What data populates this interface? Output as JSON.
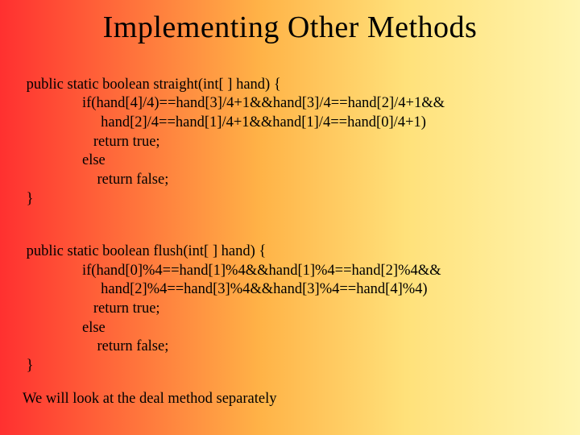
{
  "title": "Implementing Other Methods",
  "code1": {
    "l1": " public static boolean straight(int[ ] hand) {",
    "l2": "                if(hand[4]/4)==hand[3]/4+1&&hand[3]/4==hand[2]/4+1&&",
    "l3": "                     hand[2]/4==hand[1]/4+1&&hand[1]/4==hand[0]/4+1)",
    "l4": "                   return true;",
    "l5": "                else",
    "l6": "                    return false;",
    "l7": " }"
  },
  "code2": {
    "l1": " public static boolean flush(int[ ] hand) {",
    "l2": "                if(hand[0]%4==hand[1]%4&&hand[1]%4==hand[2]%4&&",
    "l3": "                     hand[2]%4==hand[3]%4&&hand[3]%4==hand[4]%4)",
    "l4": "                   return true;",
    "l5": "                else",
    "l6": "                    return false;",
    "l7": " }"
  },
  "footer": " We will look at the deal method separately"
}
